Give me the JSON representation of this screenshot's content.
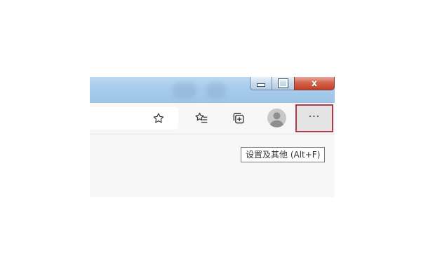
{
  "window_controls": {
    "minimize_icon": "minimize-icon",
    "maximize_icon": "restore-icon",
    "close_icon": "close-icon",
    "close_glyph": "x"
  },
  "toolbar": {
    "address_favorite_icon": "star-outline-icon",
    "favorites_icon": "favorites-list-icon",
    "collections_icon": "collections-icon",
    "profile_icon": "profile-avatar-icon",
    "more_label": "···"
  },
  "tooltip": {
    "text": "设置及其他 (Alt+F)"
  },
  "colors": {
    "titlebar": "#a7cbeb",
    "toolbar_bg": "#f7f7f7",
    "highlight_border": "#b23a48",
    "close_button": "#c44127"
  }
}
